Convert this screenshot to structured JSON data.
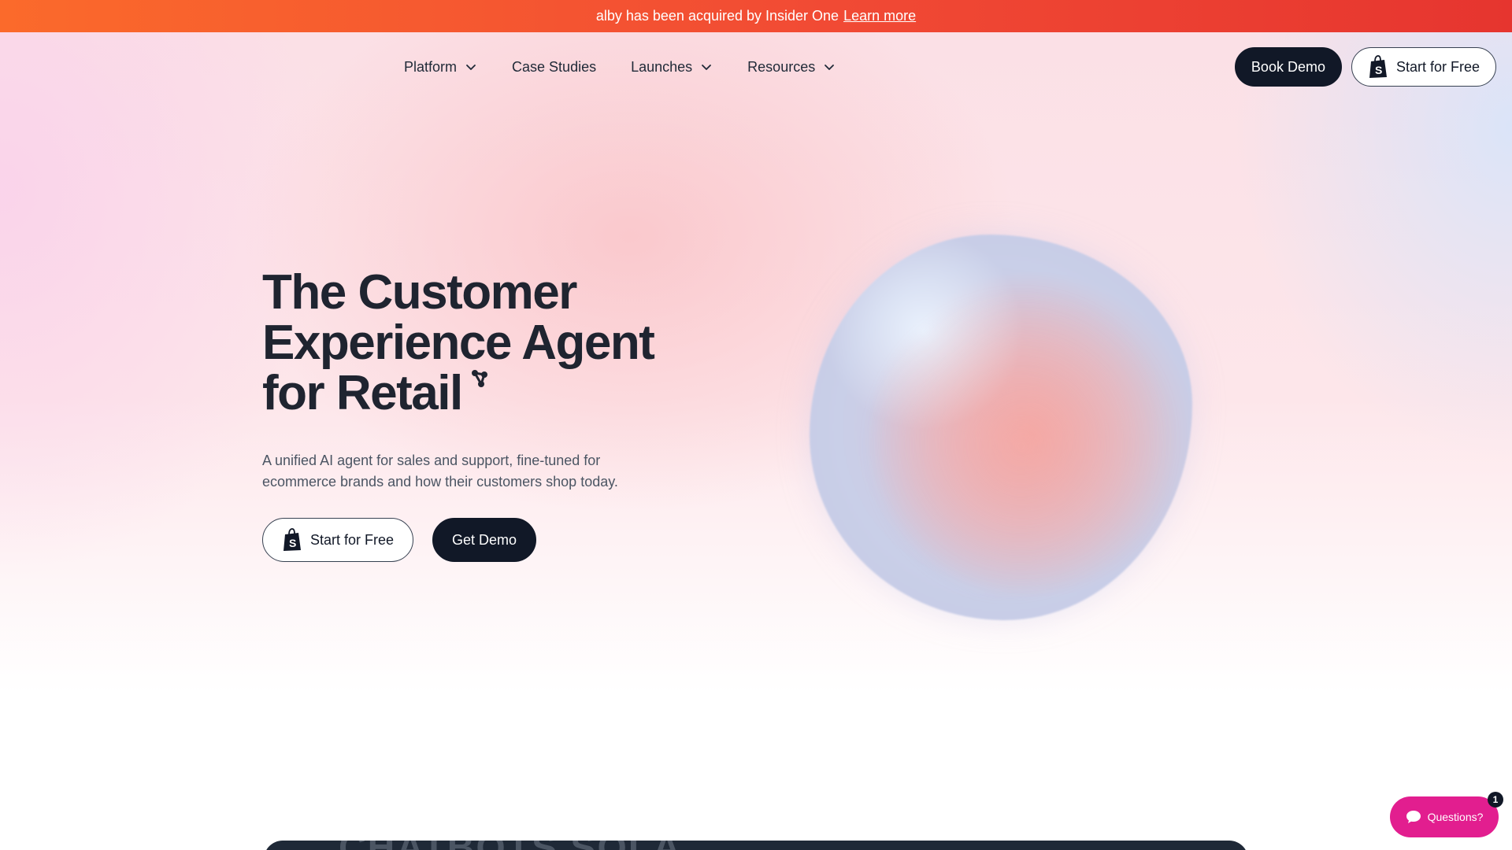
{
  "announcement": {
    "text": "alby has been acquired by Insider One",
    "link": "Learn more"
  },
  "nav": {
    "items": [
      {
        "label": "Platform",
        "dropdown": true
      },
      {
        "label": "Case Studies",
        "dropdown": false
      },
      {
        "label": "Launches",
        "dropdown": true
      },
      {
        "label": "Resources",
        "dropdown": true
      }
    ],
    "book_demo": "Book Demo",
    "start_free": "Start for Free"
  },
  "hero": {
    "title_line1": "The Customer",
    "title_line2": "Experience Agent",
    "title_line3": "for Retail",
    "subtitle": "A unified AI agent for sales and support, fine-tuned for ecommerce brands and how their customers shop today.",
    "primary_button": "Start for Free",
    "secondary_button": "Get Demo"
  },
  "bottom": {
    "partial_heading": "CHATBOTS SOLA"
  },
  "chat_widget": {
    "label": "Questions?",
    "badge_count": "1"
  },
  "colors": {
    "announcement_start": "#fb6a2b",
    "announcement_end": "#e6352f",
    "dark_button": "#111827",
    "chat_widget": "#e21e8f"
  },
  "icons": [
    "chevron-down-icon",
    "shopify-bag-icon",
    "sparkle-icon",
    "chat-bubble-icon"
  ]
}
